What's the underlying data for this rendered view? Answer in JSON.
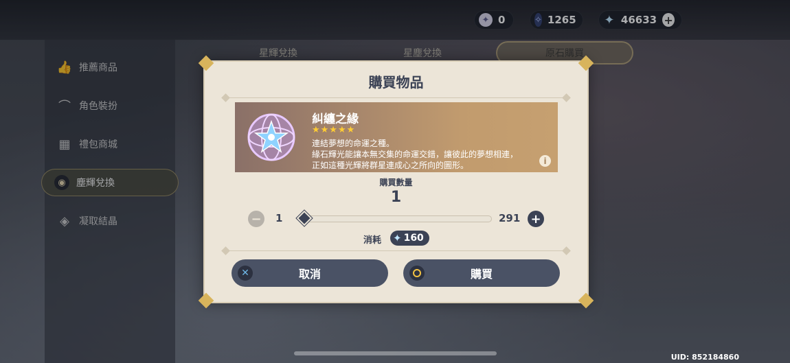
{
  "currencies": [
    {
      "name": "masterless-stardust",
      "value": "0"
    },
    {
      "name": "masterless-starglitter",
      "value": "1265"
    },
    {
      "name": "primogem",
      "value": "46633"
    }
  ],
  "sidebar": {
    "items": [
      {
        "label": "推薦商品",
        "icon": "thumbs-up-icon"
      },
      {
        "label": "角色裝扮",
        "icon": "hanger-icon"
      },
      {
        "label": "禮包商城",
        "icon": "gift-icon"
      },
      {
        "label": "塵輝兌換",
        "icon": "bag-icon",
        "active": true
      },
      {
        "label": "凝取結晶",
        "icon": "crystal-icon"
      }
    ]
  },
  "tabs": [
    {
      "label": "星輝兌換"
    },
    {
      "label": "星塵兌換"
    },
    {
      "label": "原石購買",
      "active": true
    }
  ],
  "modal": {
    "title": "購買物品",
    "item": {
      "name": "糾纏之緣",
      "stars": "★★★★★",
      "desc_lines": [
        "連結夢想的命運之種。",
        "緣石輝光能讓本無交集的命運交錯，讓彼此的夢想相連，",
        "正如這種光輝將群星連成心之所向的圖形。"
      ]
    },
    "quantity_label": "購買數量",
    "quantity": "1",
    "min": "1",
    "max": "291",
    "slider_fraction": 0,
    "cost_label": "消耗",
    "cost": "160",
    "cancel_label": "取消",
    "buy_label": "購買"
  },
  "uid": "UID: 852184860",
  "colors": {
    "accent": "#3b4255",
    "gold": "#d8b45c",
    "modal_bg": "#ece5d8"
  }
}
